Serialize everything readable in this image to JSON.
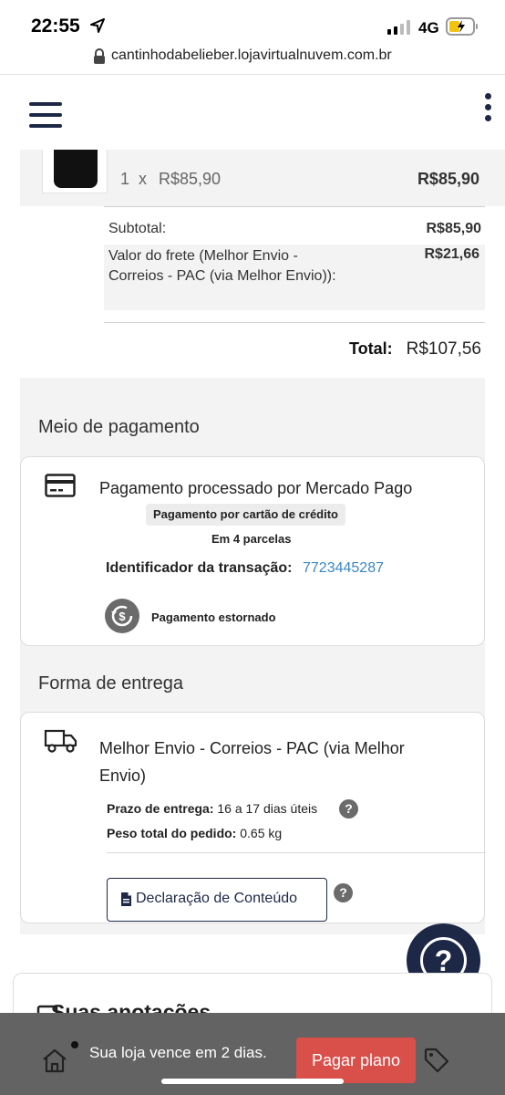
{
  "status_bar": {
    "time": "22:55",
    "network": "4G"
  },
  "url_bar": {
    "url": "cantinhodabelieber.lojavirtualnuvem.com.br"
  },
  "header": {
    "menu_icon": "hamburger-icon",
    "more_icon": "kebab-icon"
  },
  "order_item": {
    "quantity": "1",
    "times": "x",
    "unit_price": "R$85,90",
    "line_total": "R$85,90"
  },
  "totals": {
    "subtotal_label": "Subtotal:",
    "subtotal_value": "R$85,90",
    "shipping_label": "Valor do frete (Melhor Envio - Correios - PAC (via Melhor Envio)):",
    "shipping_value": "R$21,66",
    "total_label": "Total:",
    "total_value": "R$107,56"
  },
  "payment": {
    "section_title": "Meio de pagamento",
    "title": "Pagamento processado por Mercado Pago",
    "method_badge": "Pagamento por cartão de crédito",
    "installments": "Em 4 parcelas",
    "transaction_label": "Identificador da transação:",
    "transaction_id": "7723445287",
    "status": "Pagamento estornado"
  },
  "delivery": {
    "section_title": "Forma de entrega",
    "method": "Melhor Envio - Correios - PAC (via Melhor Envio)",
    "deadline_label": "Prazo de entrega:",
    "deadline_value": "16 a 17 dias úteis",
    "weight_label": "Peso total do pedido:",
    "weight_value": "0.65 kg",
    "declaration_button": "Declaração de Conteúdo"
  },
  "notes": {
    "title": "Suas anotações"
  },
  "banner": {
    "message": "Sua loja vence em 2 dias.",
    "button": "Pagar plano"
  },
  "colors": {
    "navy": "#1d2847",
    "link": "#3a86c8",
    "cta": "#d9504b",
    "panel": "#f3f3f3"
  }
}
